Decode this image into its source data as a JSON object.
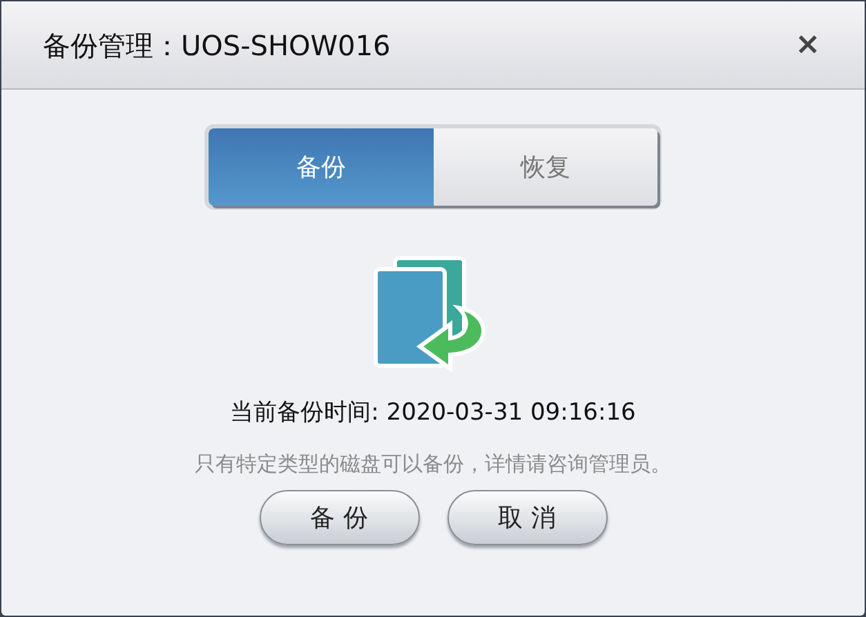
{
  "window": {
    "title": "备份管理：UOS-SHOW016",
    "close": "×"
  },
  "tabs": [
    {
      "label": "备份",
      "selected": true
    },
    {
      "label": "恢复",
      "selected": false
    }
  ],
  "backup_time": {
    "label": "当前备份时间:",
    "value": "2020-03-31 09:16:16"
  },
  "note": "只有特定类型的磁盘可以备份，详情请咨询管理员。",
  "buttons": [
    "备 份",
    "取 消"
  ]
}
